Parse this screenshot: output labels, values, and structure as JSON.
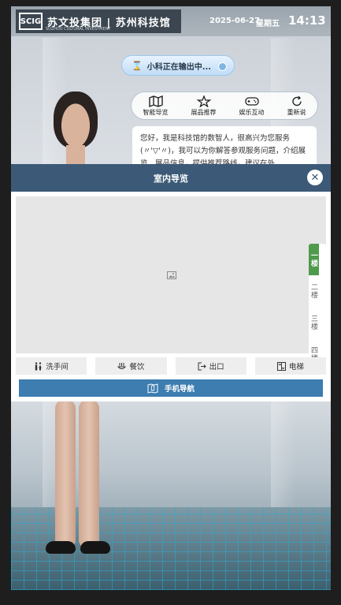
{
  "header": {
    "logo_mark": "SCIG",
    "logo_text": "苏文投集团 | 苏州科技馆",
    "logo_sub": "SUZHOU CULTURAL INVESTMENT",
    "date": "2025-06-27",
    "weekday": "星期五",
    "time": "14:13"
  },
  "status": {
    "text": "小科正在输出中..."
  },
  "actions": [
    {
      "label": "智能导览",
      "icon": "map-icon"
    },
    {
      "label": "展品推荐",
      "icon": "star-icon"
    },
    {
      "label": "娱乐互动",
      "icon": "gamepad-icon"
    },
    {
      "label": "重新说",
      "icon": "refresh-icon"
    }
  ],
  "chat": {
    "text": "您好，我是科技馆的数智人，很高兴为您服务(〃'▽'〃)，我可以为你解答参观服务问题，介绍展览、展品信息，提供推荐路线，建议在外"
  },
  "modal": {
    "title": "室内导览",
    "close_icon": "close-icon",
    "floors": [
      {
        "label": "一楼",
        "active": true
      },
      {
        "label": "二楼",
        "active": false
      },
      {
        "label": "三楼",
        "active": false
      },
      {
        "label": "四楼",
        "active": false
      }
    ],
    "facilities": [
      {
        "label": "洗手间",
        "icon": "restroom-icon"
      },
      {
        "label": "餐饮",
        "icon": "dining-icon"
      },
      {
        "label": "出口",
        "icon": "exit-icon"
      },
      {
        "label": "电梯",
        "icon": "elevator-icon"
      }
    ],
    "mobile_nav": "手机导航"
  }
}
